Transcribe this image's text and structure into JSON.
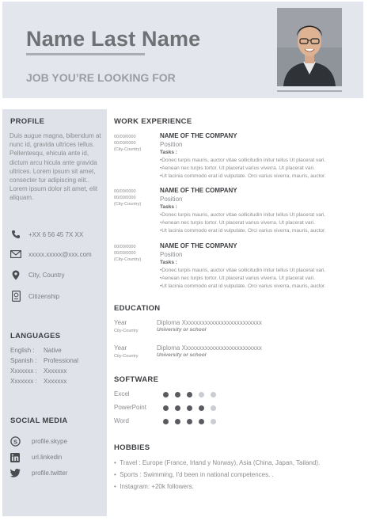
{
  "header": {
    "name": "Name Last Name",
    "job_title": "JOB YOU’RE LOOKING FOR"
  },
  "sidebar": {
    "profile_title": "PROFILE",
    "profile_text": "Duis augue magna, bibendum at nunc id, gravida ultrices tellus. Pellentesqu, ehicula ante id, dictum arcu hicula ante gravida ultrices. Lorem ipsum sit amet, consecter tur adipiscing elit.. Lorem ipsum dolor sit amet, elit aliquam.",
    "contacts": [
      {
        "icon": "phone-icon",
        "text": "+XX 6 56 45 7X XX"
      },
      {
        "icon": "mail-icon",
        "text": "xxxxx.xxxxx@xxx.com"
      },
      {
        "icon": "location-pin-icon",
        "text": "City, Country"
      },
      {
        "icon": "passport-icon",
        "text": "Citizenship"
      }
    ],
    "languages_title": "LANGUAGES",
    "languages": [
      {
        "name": "English :",
        "level": "Native"
      },
      {
        "name": "Spanish :",
        "level": "Professional"
      },
      {
        "name": "Xxxxxxx :",
        "level": "Xxxxxxx"
      },
      {
        "name": "Xxxxxxx :",
        "level": "Xxxxxxx"
      }
    ],
    "social_title": "SOCIAL MEDIA",
    "social": [
      {
        "icon": "skype-icon",
        "text": "profile.skype"
      },
      {
        "icon": "linkedin-icon",
        "text": "url.linkedin"
      },
      {
        "icon": "twitter-icon",
        "text": "profile.twitter"
      }
    ]
  },
  "work": {
    "title": "WORK EXPERIENCE",
    "jobs": [
      {
        "date_from": "00/00/0000",
        "date_to": "00/00/0000",
        "location": "(City-Country)",
        "company": "NAME OF THE COMPANY",
        "position": "Position",
        "tasks_label": "Tasks :",
        "tasks": [
          "Donec turpis mauris, auctor vitae sollicitudin initur tellus Ut placerat vari.",
          "Aenean nec turpis tortor. Ut placerat varius viverra. Ut placerat vari.",
          "Ut lacinia commodo erat id vulputate. Orci varius viverra, mauris, auctor."
        ]
      },
      {
        "date_from": "00/00/0000",
        "date_to": "00/00/0000",
        "location": "(City-Country)",
        "company": "NAME OF THE COMPANY",
        "position": "Position",
        "tasks_label": "Tasks :",
        "tasks": [
          "Donec turpis mauris, auctor vitae sollicitudin initur tellus Ut placerat vari.",
          "Aenean nec turpis tortor. Ut placerat varius viverra. Ut placerat vari.",
          "Ut lacinia commodo erat id vulputate. Orci varius viverra, mauris, auctor."
        ]
      },
      {
        "date_from": "00/00/0000",
        "date_to": "00/00/0000",
        "location": "(City-Country)",
        "company": "NAME OF THE COMPANY",
        "position": "Position",
        "tasks_label": "Tasks :",
        "tasks": [
          "Donec turpis mauris, auctor vitae sollicitudin initur tellus Ut placerat vari.",
          "Aenean nec turpis tortor. Ut placerat varius viverra. Ut placerat vari.",
          "Ut lacinia commodo erat id vulputate. Orci varius viverra, mauris, auctor."
        ]
      }
    ]
  },
  "education": {
    "title": "EDUCATION",
    "items": [
      {
        "year": "Year",
        "location": "City-Country",
        "diploma": "Diploma Xxxxxxxxxxxxxxxxxxxxxxxxx",
        "school": "University or school"
      },
      {
        "year": "Year",
        "location": "City-Country",
        "diploma": "Diploma Xxxxxxxxxxxxxxxxxxxxxxxxx",
        "school": "University or school"
      }
    ]
  },
  "software": {
    "title": "SOFTWARE",
    "items": [
      {
        "name": "Excel",
        "rating": 3,
        "max": 5
      },
      {
        "name": "PowerPoint",
        "rating": 4,
        "max": 5
      },
      {
        "name": "Word",
        "rating": 4,
        "max": 5
      }
    ]
  },
  "hobbies": {
    "title": "HOBBIES",
    "items": [
      "Travel : Europe (France, Irland y Norway), Asia (China, Japan, Tailand).",
      "Sports : Swimming, I'd been in national competences. .",
      "Instagram: +20k followers."
    ]
  },
  "colors": {
    "header_bg": "#e3e6ec",
    "sidebar_bg": "#dfe3e9",
    "dot_filled": "#595b5e",
    "dot_empty": "#c9ccd0"
  }
}
